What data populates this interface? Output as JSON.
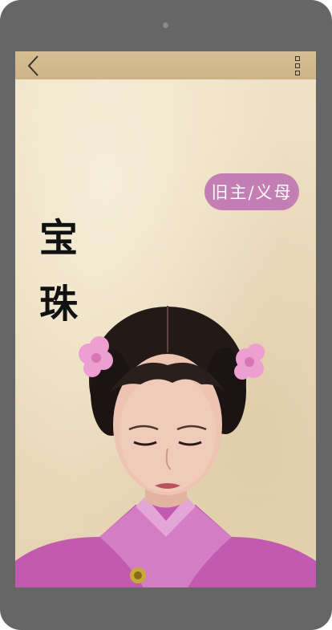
{
  "app": {
    "back_icon": "chevron-left-icon",
    "menu_icon": "vertical-squares-menu-icon"
  },
  "character": {
    "name_chars": [
      "宝",
      "珠"
    ],
    "relation_tag": "旧主/义母"
  },
  "colors": {
    "frame": "#666666",
    "nav_bar": "#d1b98c",
    "page_background": "#ebdcbd",
    "tag_background": "#c37fb3",
    "tag_text": "#ffffff",
    "name_text": "#111111"
  }
}
